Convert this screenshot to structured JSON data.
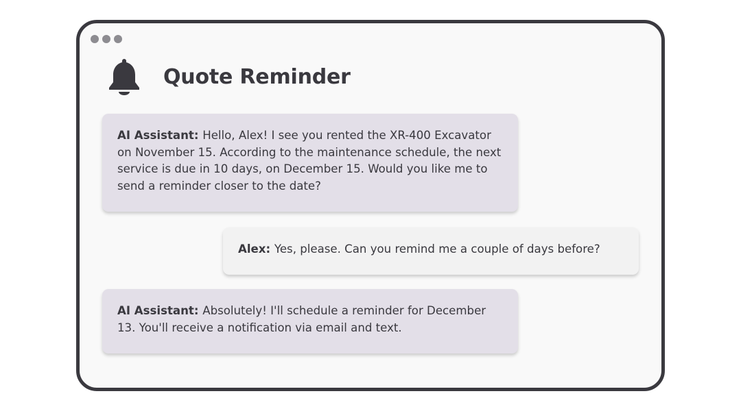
{
  "window": {
    "title": "Quote Reminder",
    "icon": "bell-icon"
  },
  "messages": [
    {
      "speaker": "AI Assistant:",
      "text": "Hello, Alex! I see you rented the XR-400 Excavator on November 15. According to the maintenance schedule, the next service is due in 10 days, on December 15. Would you like me to send a reminder closer to the date?"
    },
    {
      "speaker": "Alex:",
      "text": "Yes, please. Can you remind me a couple of days before?"
    },
    {
      "speaker": "AI Assistant:",
      "text": "Absolutely! I'll schedule a reminder for December 13. You'll receive a notification via email and text."
    }
  ],
  "colors": {
    "frame": "#3a393f",
    "window_bg": "#f9f9f9",
    "assistant_bubble": "#e3dfe8",
    "user_bubble": "#f2f2f2",
    "text": "#3a393f",
    "traffic_dot": "#8d8c91"
  }
}
